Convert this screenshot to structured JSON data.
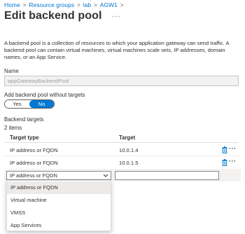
{
  "breadcrumb": {
    "items": [
      "Home",
      "Resource groups",
      "lab",
      "AGW1"
    ]
  },
  "header": {
    "title": "Edit backend pool",
    "more": "···"
  },
  "description": "A backend pool is a collection of resources to which your application gateway can send traffic. A backend pool can contain virtual machines, virtual machines scale sets, IP addresses, domain names, or an App Service.",
  "name_field": {
    "label": "Name",
    "value": "appGatewayBackendPool"
  },
  "without_targets": {
    "label": "Add backend pool without targets",
    "options": [
      "Yes",
      "No"
    ],
    "selected": "No"
  },
  "backend_targets": {
    "label": "Backend targets",
    "count": "2 items",
    "columns": [
      "Target type",
      "Target"
    ],
    "rows": [
      {
        "type": "IP address or FQDN",
        "target": "10.0.1.4"
      },
      {
        "type": "IP address or FQDN",
        "target": "10.0.1.5"
      }
    ],
    "row_more": "···",
    "new_row": {
      "selected_type": "IP address or FQDN",
      "target_value": ""
    },
    "dropdown_options": [
      "IP address or FQDN",
      "Virtual machine",
      "VMSS",
      "App Services"
    ]
  },
  "colors": {
    "accent": "#0078d4",
    "text": "#323130",
    "border": "#8a8886",
    "disabled_bg": "#f3f2f1"
  },
  "icons": {
    "row_delete": "trash-icon",
    "row_more": "more-icon",
    "select": "chevron-down-icon"
  }
}
